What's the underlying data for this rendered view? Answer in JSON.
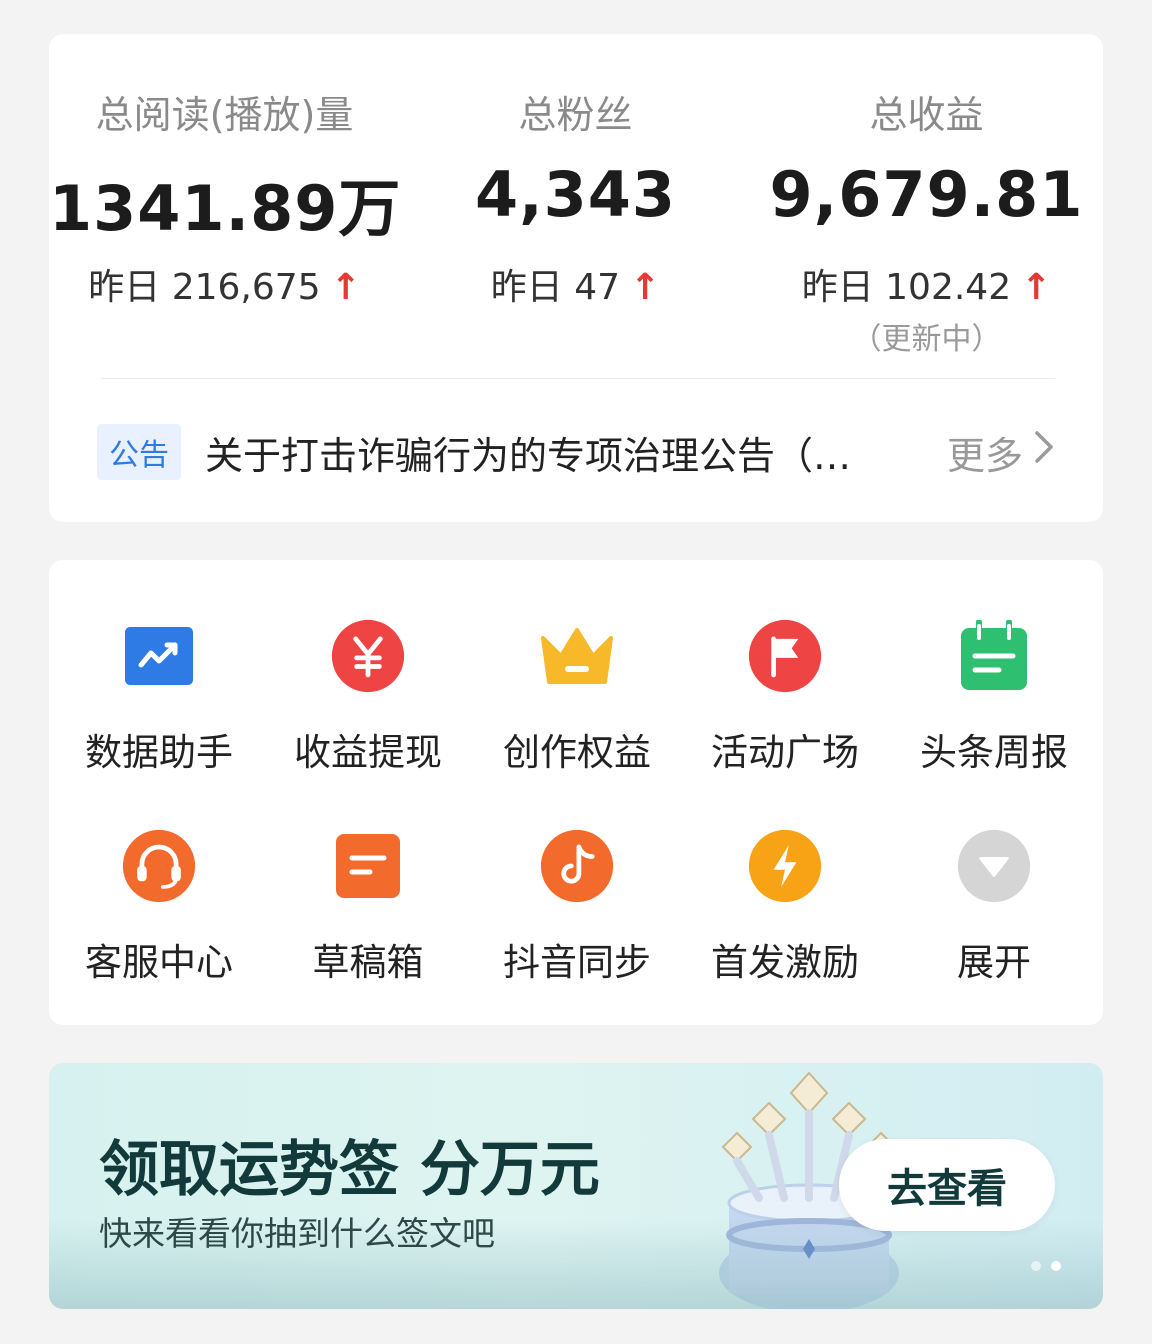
{
  "stats": [
    {
      "label": "总阅读(播放)量",
      "value": "1341.89万",
      "yesterday": "昨日 216,675",
      "trend": "↑",
      "note": ""
    },
    {
      "label": "总粉丝",
      "value": "4,343",
      "yesterday": "昨日 47",
      "trend": "↑",
      "note": ""
    },
    {
      "label": "总收益",
      "value": "9,679.81",
      "yesterday": "昨日 102.42",
      "trend": "↑",
      "note": "（更新中）"
    }
  ],
  "notice": {
    "tag": "公告",
    "text": "关于打击诈骗行为的专项治理公告（…",
    "more": "更多"
  },
  "tools": [
    {
      "label": "数据助手",
      "icon": "chart-icon",
      "color": "#2f7be5"
    },
    {
      "label": "收益提现",
      "icon": "yen-icon",
      "color": "#ef4444"
    },
    {
      "label": "创作权益",
      "icon": "crown-icon",
      "color": "#f7b829"
    },
    {
      "label": "活动广场",
      "icon": "flag-icon",
      "color": "#ef4444"
    },
    {
      "label": "头条周报",
      "icon": "calendar-icon",
      "color": "#2fbf71"
    },
    {
      "label": "客服中心",
      "icon": "headset-icon",
      "color": "#f26b2d"
    },
    {
      "label": "草稿箱",
      "icon": "draft-icon",
      "color": "#f26b2d"
    },
    {
      "label": "抖音同步",
      "icon": "music-note-icon",
      "color": "#f26b2d"
    },
    {
      "label": "首发激励",
      "icon": "lightning-icon",
      "color": "#f8a316"
    },
    {
      "label": "展开",
      "icon": "expand-icon",
      "color": "#d5d5d5"
    }
  ],
  "banner": {
    "title": "领取运势签 分万元",
    "subtitle": "快来看看你抽到什么签文吧",
    "button": "去查看",
    "slides": 2,
    "active_slide": 2
  }
}
